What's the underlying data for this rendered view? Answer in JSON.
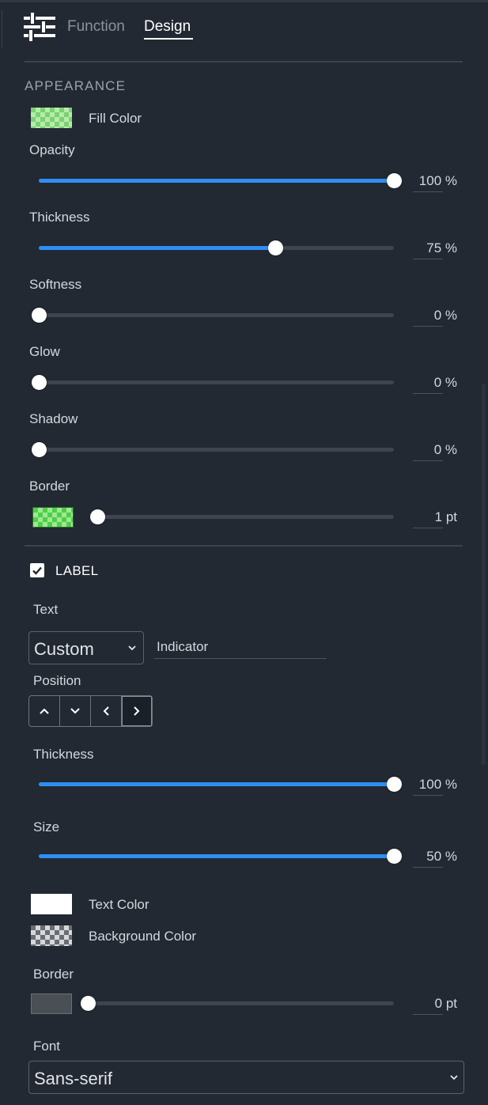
{
  "header": {
    "icon": "sliders-icon",
    "tabs": [
      {
        "label": "Function",
        "active": false
      },
      {
        "label": "Design",
        "active": true
      }
    ]
  },
  "appearance": {
    "title": "APPEARANCE",
    "fill_color_label": "Fill Color",
    "opacity": {
      "label": "Opacity",
      "value": 100,
      "display": "100 %"
    },
    "thickness": {
      "label": "Thickness",
      "value": 75,
      "display": "75 %"
    },
    "softness": {
      "label": "Softness",
      "value": 0,
      "display": "0 %"
    },
    "glow": {
      "label": "Glow",
      "value": 0,
      "display": "0 %"
    },
    "shadow": {
      "label": "Shadow",
      "value": 0,
      "display": "0 %"
    },
    "border": {
      "label": "Border",
      "value": 1,
      "display": "1 pt"
    }
  },
  "label_section": {
    "title": "LABEL",
    "checked": true,
    "text_label": "Text",
    "text_mode": "Custom",
    "text_value": "Indicator",
    "position_label": "Position",
    "position_selected": "right",
    "thickness": {
      "label": "Thickness",
      "value": 100,
      "display": "100 %"
    },
    "size": {
      "label": "Size",
      "value": 50,
      "display": "50 %"
    },
    "text_color_label": "Text Color",
    "background_color_label": "Background Color",
    "border": {
      "label": "Border",
      "value": 0,
      "display": "0 pt"
    },
    "font_label": "Font",
    "font_value": "Sans-serif"
  },
  "colors": {
    "background": "#222932",
    "accent": "#2f8ef5",
    "fill_color": "#7ad36e",
    "border_color": "#4fcf48",
    "text_color": "#ffffff",
    "label_border_color": "#4a4f56"
  }
}
